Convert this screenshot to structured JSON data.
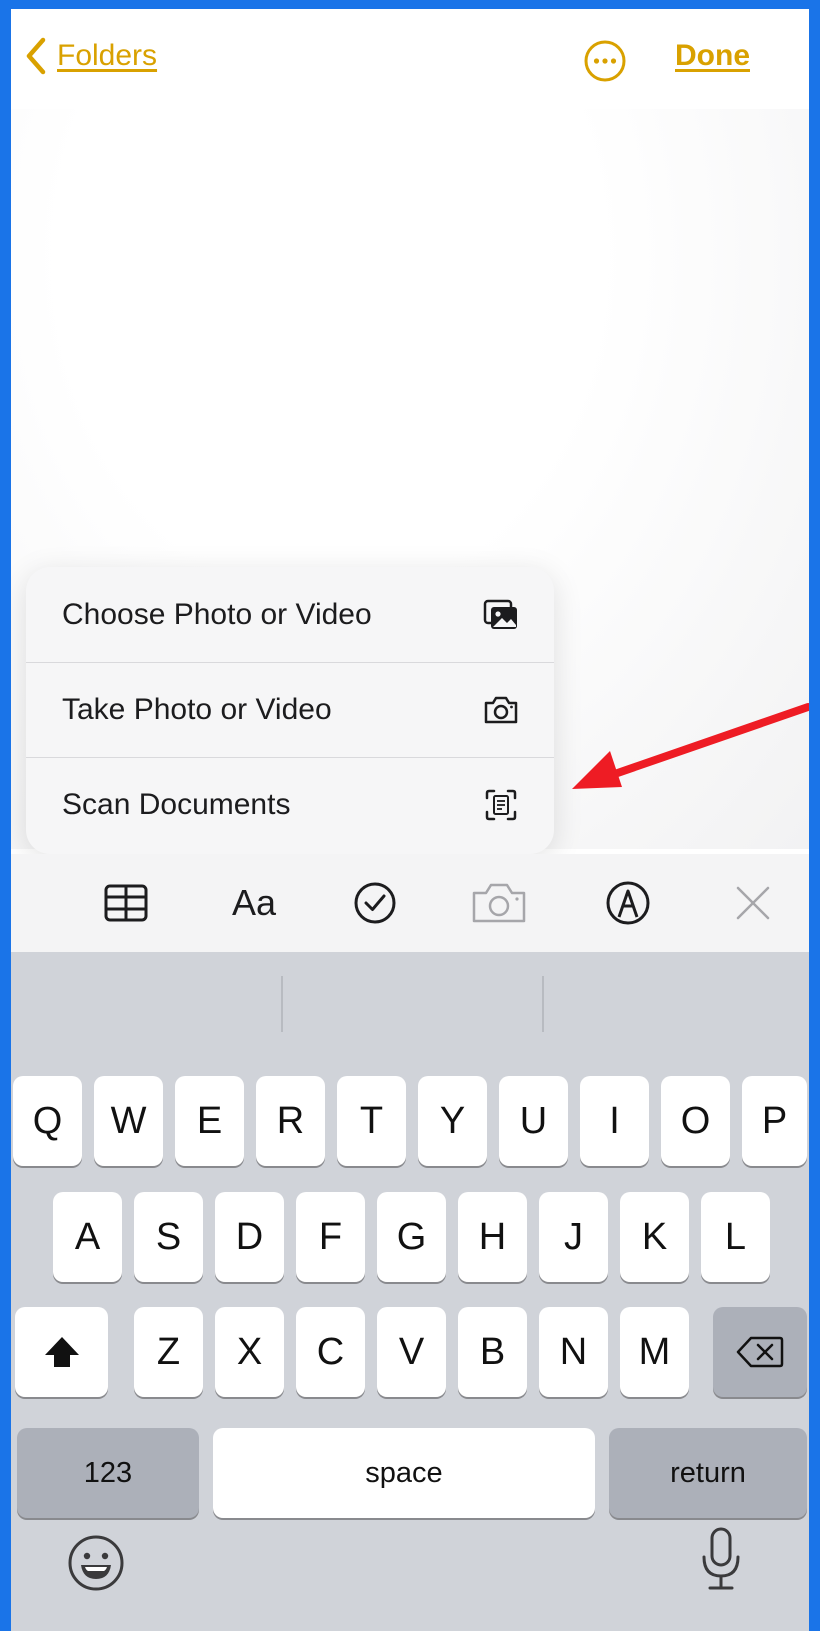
{
  "nav": {
    "back_label": "Folders",
    "done_label": "Done"
  },
  "menu": {
    "items": [
      {
        "label": "Choose Photo or Video",
        "icon": "photo-library-icon"
      },
      {
        "label": "Take Photo or Video",
        "icon": "camera-icon"
      },
      {
        "label": "Scan Documents",
        "icon": "scan-document-icon"
      }
    ]
  },
  "toolbar": {
    "format_label": "Aa",
    "tools": [
      "table-icon",
      "format-text",
      "checklist-icon",
      "camera-icon",
      "markup-icon",
      "close-icon"
    ]
  },
  "keyboard": {
    "row1": [
      "Q",
      "W",
      "E",
      "R",
      "T",
      "Y",
      "U",
      "I",
      "O",
      "P"
    ],
    "row2": [
      "A",
      "S",
      "D",
      "F",
      "G",
      "H",
      "J",
      "K",
      "L"
    ],
    "row3": [
      "Z",
      "X",
      "C",
      "V",
      "B",
      "N",
      "M"
    ],
    "numbers_label": "123",
    "space_label": "space",
    "return_label": "return"
  },
  "colors": {
    "accent": "#d9a100",
    "frame_border": "#1a74e8",
    "annotation_arrow": "#ee1c24"
  }
}
